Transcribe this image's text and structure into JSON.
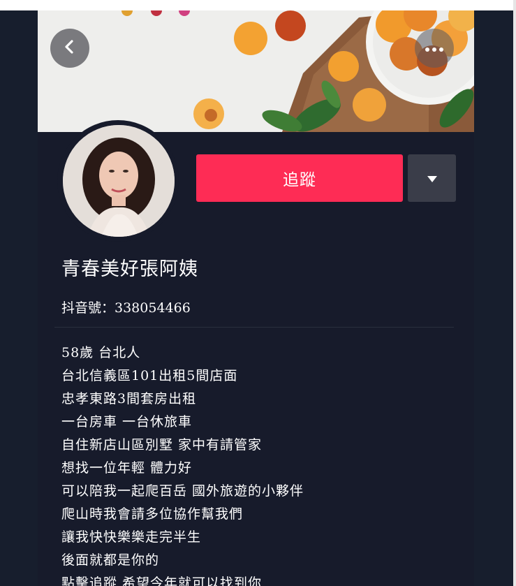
{
  "header": {
    "back_icon": "chevron-left-icon",
    "more_icon": "more-horizontal-icon"
  },
  "profile": {
    "follow_label": "追蹤",
    "dropdown_icon": "caret-down-icon",
    "nickname": "青春美好張阿姨",
    "douyin_id": "抖音號：338054466",
    "bio": [
      "58歲 台北人",
      "台北信義區101出租5間店面",
      "忠孝東路3間套房出租",
      "一台房車 一台休旅車",
      "自住新店山區別墅 家中有請管家",
      "想找一位年輕 體力好",
      "可以陪我一起爬百岳 國外旅遊的小夥伴",
      "爬山時我會請多位協作幫我們",
      "讓我快快樂樂走完半生",
      "後面就都是你的",
      "點擊追蹤 希望今年就可以找到你"
    ]
  },
  "colors": {
    "background": "#171b2b",
    "follow_button": "#fe2c55",
    "dropdown_button": "#3a3d49",
    "text": "#ffffff"
  }
}
